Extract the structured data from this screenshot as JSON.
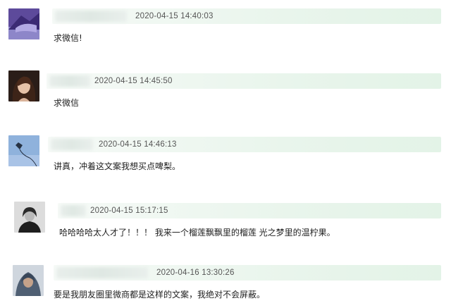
{
  "comments": [
    {
      "avatar": "purple-abstract-avatar",
      "time": "2020-04-15 14:40:03",
      "text": "求微信!"
    },
    {
      "avatar": "woman-portrait-avatar",
      "time": "2020-04-15 14:45:50",
      "text": "求微信"
    },
    {
      "avatar": "kite-sky-avatar",
      "time": "2020-04-15 14:46:13",
      "text": "讲真，冲着这文案我想买点啤梨。"
    },
    {
      "avatar": "bw-portrait-avatar",
      "time": "2020-04-15 15:17:15",
      "text": "哈哈哈哈太人才了！！！ 我来一个榴莲飘飘里的榴莲 光之梦里的温柠果。"
    },
    {
      "avatar": "hooded-person-avatar",
      "time": "2020-04-16 13:30:26",
      "text": "要是我朋友圈里微商都是这样的文案，我绝对不会屏蔽。"
    }
  ]
}
